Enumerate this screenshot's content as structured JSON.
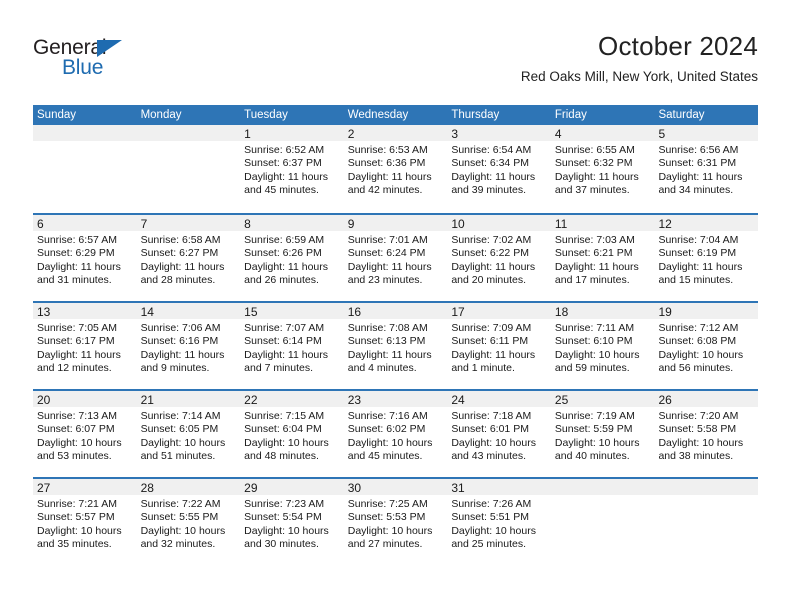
{
  "brand": {
    "name_part1": "General",
    "name_part2": "Blue",
    "triangle_icon": "triangle-icon",
    "colors": {
      "black": "#231f20",
      "blue": "#1e6bb0"
    }
  },
  "header": {
    "title": "October 2024",
    "subtitle": "Red Oaks Mill, New York, United States"
  },
  "theme": {
    "header_bg": "#2e75b6",
    "header_text": "#ffffff",
    "daynum_band": "#f0f0f0",
    "row_divider": "#2e75b6"
  },
  "weekdays": [
    "Sunday",
    "Monday",
    "Tuesday",
    "Wednesday",
    "Thursday",
    "Friday",
    "Saturday"
  ],
  "weeks": [
    [
      {
        "day": "",
        "sunrise": "",
        "sunset": "",
        "daylight1": "",
        "daylight2": "",
        "empty": true
      },
      {
        "day": "",
        "sunrise": "",
        "sunset": "",
        "daylight1": "",
        "daylight2": "",
        "empty": true
      },
      {
        "day": "1",
        "sunrise": "Sunrise: 6:52 AM",
        "sunset": "Sunset: 6:37 PM",
        "daylight1": "Daylight: 11 hours",
        "daylight2": "and 45 minutes."
      },
      {
        "day": "2",
        "sunrise": "Sunrise: 6:53 AM",
        "sunset": "Sunset: 6:36 PM",
        "daylight1": "Daylight: 11 hours",
        "daylight2": "and 42 minutes."
      },
      {
        "day": "3",
        "sunrise": "Sunrise: 6:54 AM",
        "sunset": "Sunset: 6:34 PM",
        "daylight1": "Daylight: 11 hours",
        "daylight2": "and 39 minutes."
      },
      {
        "day": "4",
        "sunrise": "Sunrise: 6:55 AM",
        "sunset": "Sunset: 6:32 PM",
        "daylight1": "Daylight: 11 hours",
        "daylight2": "and 37 minutes."
      },
      {
        "day": "5",
        "sunrise": "Sunrise: 6:56 AM",
        "sunset": "Sunset: 6:31 PM",
        "daylight1": "Daylight: 11 hours",
        "daylight2": "and 34 minutes."
      }
    ],
    [
      {
        "day": "6",
        "sunrise": "Sunrise: 6:57 AM",
        "sunset": "Sunset: 6:29 PM",
        "daylight1": "Daylight: 11 hours",
        "daylight2": "and 31 minutes."
      },
      {
        "day": "7",
        "sunrise": "Sunrise: 6:58 AM",
        "sunset": "Sunset: 6:27 PM",
        "daylight1": "Daylight: 11 hours",
        "daylight2": "and 28 minutes."
      },
      {
        "day": "8",
        "sunrise": "Sunrise: 6:59 AM",
        "sunset": "Sunset: 6:26 PM",
        "daylight1": "Daylight: 11 hours",
        "daylight2": "and 26 minutes."
      },
      {
        "day": "9",
        "sunrise": "Sunrise: 7:01 AM",
        "sunset": "Sunset: 6:24 PM",
        "daylight1": "Daylight: 11 hours",
        "daylight2": "and 23 minutes."
      },
      {
        "day": "10",
        "sunrise": "Sunrise: 7:02 AM",
        "sunset": "Sunset: 6:22 PM",
        "daylight1": "Daylight: 11 hours",
        "daylight2": "and 20 minutes."
      },
      {
        "day": "11",
        "sunrise": "Sunrise: 7:03 AM",
        "sunset": "Sunset: 6:21 PM",
        "daylight1": "Daylight: 11 hours",
        "daylight2": "and 17 minutes."
      },
      {
        "day": "12",
        "sunrise": "Sunrise: 7:04 AM",
        "sunset": "Sunset: 6:19 PM",
        "daylight1": "Daylight: 11 hours",
        "daylight2": "and 15 minutes."
      }
    ],
    [
      {
        "day": "13",
        "sunrise": "Sunrise: 7:05 AM",
        "sunset": "Sunset: 6:17 PM",
        "daylight1": "Daylight: 11 hours",
        "daylight2": "and 12 minutes."
      },
      {
        "day": "14",
        "sunrise": "Sunrise: 7:06 AM",
        "sunset": "Sunset: 6:16 PM",
        "daylight1": "Daylight: 11 hours",
        "daylight2": "and 9 minutes."
      },
      {
        "day": "15",
        "sunrise": "Sunrise: 7:07 AM",
        "sunset": "Sunset: 6:14 PM",
        "daylight1": "Daylight: 11 hours",
        "daylight2": "and 7 minutes."
      },
      {
        "day": "16",
        "sunrise": "Sunrise: 7:08 AM",
        "sunset": "Sunset: 6:13 PM",
        "daylight1": "Daylight: 11 hours",
        "daylight2": "and 4 minutes."
      },
      {
        "day": "17",
        "sunrise": "Sunrise: 7:09 AM",
        "sunset": "Sunset: 6:11 PM",
        "daylight1": "Daylight: 11 hours",
        "daylight2": "and 1 minute."
      },
      {
        "day": "18",
        "sunrise": "Sunrise: 7:11 AM",
        "sunset": "Sunset: 6:10 PM",
        "daylight1": "Daylight: 10 hours",
        "daylight2": "and 59 minutes."
      },
      {
        "day": "19",
        "sunrise": "Sunrise: 7:12 AM",
        "sunset": "Sunset: 6:08 PM",
        "daylight1": "Daylight: 10 hours",
        "daylight2": "and 56 minutes."
      }
    ],
    [
      {
        "day": "20",
        "sunrise": "Sunrise: 7:13 AM",
        "sunset": "Sunset: 6:07 PM",
        "daylight1": "Daylight: 10 hours",
        "daylight2": "and 53 minutes."
      },
      {
        "day": "21",
        "sunrise": "Sunrise: 7:14 AM",
        "sunset": "Sunset: 6:05 PM",
        "daylight1": "Daylight: 10 hours",
        "daylight2": "and 51 minutes."
      },
      {
        "day": "22",
        "sunrise": "Sunrise: 7:15 AM",
        "sunset": "Sunset: 6:04 PM",
        "daylight1": "Daylight: 10 hours",
        "daylight2": "and 48 minutes."
      },
      {
        "day": "23",
        "sunrise": "Sunrise: 7:16 AM",
        "sunset": "Sunset: 6:02 PM",
        "daylight1": "Daylight: 10 hours",
        "daylight2": "and 45 minutes."
      },
      {
        "day": "24",
        "sunrise": "Sunrise: 7:18 AM",
        "sunset": "Sunset: 6:01 PM",
        "daylight1": "Daylight: 10 hours",
        "daylight2": "and 43 minutes."
      },
      {
        "day": "25",
        "sunrise": "Sunrise: 7:19 AM",
        "sunset": "Sunset: 5:59 PM",
        "daylight1": "Daylight: 10 hours",
        "daylight2": "and 40 minutes."
      },
      {
        "day": "26",
        "sunrise": "Sunrise: 7:20 AM",
        "sunset": "Sunset: 5:58 PM",
        "daylight1": "Daylight: 10 hours",
        "daylight2": "and 38 minutes."
      }
    ],
    [
      {
        "day": "27",
        "sunrise": "Sunrise: 7:21 AM",
        "sunset": "Sunset: 5:57 PM",
        "daylight1": "Daylight: 10 hours",
        "daylight2": "and 35 minutes."
      },
      {
        "day": "28",
        "sunrise": "Sunrise: 7:22 AM",
        "sunset": "Sunset: 5:55 PM",
        "daylight1": "Daylight: 10 hours",
        "daylight2": "and 32 minutes."
      },
      {
        "day": "29",
        "sunrise": "Sunrise: 7:23 AM",
        "sunset": "Sunset: 5:54 PM",
        "daylight1": "Daylight: 10 hours",
        "daylight2": "and 30 minutes."
      },
      {
        "day": "30",
        "sunrise": "Sunrise: 7:25 AM",
        "sunset": "Sunset: 5:53 PM",
        "daylight1": "Daylight: 10 hours",
        "daylight2": "and 27 minutes."
      },
      {
        "day": "31",
        "sunrise": "Sunrise: 7:26 AM",
        "sunset": "Sunset: 5:51 PM",
        "daylight1": "Daylight: 10 hours",
        "daylight2": "and 25 minutes."
      },
      {
        "day": "",
        "sunrise": "",
        "sunset": "",
        "daylight1": "",
        "daylight2": "",
        "empty": true
      },
      {
        "day": "",
        "sunrise": "",
        "sunset": "",
        "daylight1": "",
        "daylight2": "",
        "empty": true
      }
    ]
  ]
}
